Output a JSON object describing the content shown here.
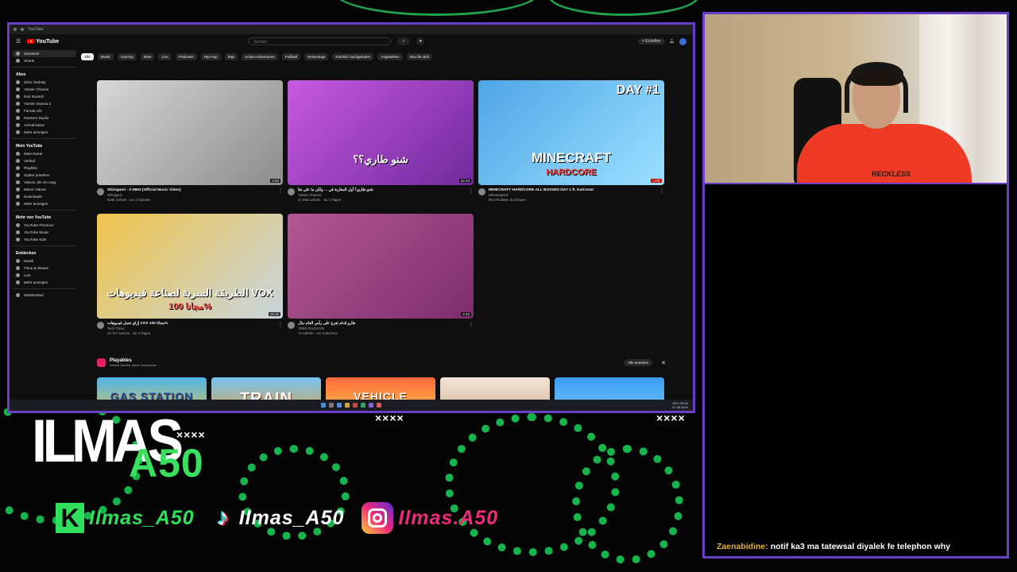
{
  "browser": {
    "tab_title": "YouTube",
    "logo_text": "YouTube",
    "search_placeholder": "Suchen",
    "create_label": "+ Erstellen",
    "chips": [
      "Alle",
      "Musik",
      "Gaming",
      "Mixe",
      "Live",
      "Podcasts",
      "Hip-Hop",
      "Rap",
      "Action-Adventures",
      "Fußball",
      "Reisevlogs",
      "Kürzlich hochgeladen",
      "Angesehen",
      "Neu für dich"
    ],
    "sidebar": {
      "top": [
        "Startseite",
        "Shorts"
      ],
      "subs_head": "Abos",
      "subs": [
        "Simo Sedraty",
        "Yasser Chanea",
        "Ilias Soumiti",
        "Yasser chanea 2",
        "Farouk Life",
        "Ransom Studio",
        "Achraf kabur",
        "Mehr anzeigen"
      ],
      "you_head": "Mein YouTube",
      "you": [
        "Mein Kanal",
        "Verlauf",
        "Playlists",
        "Später ansehen",
        "Videos, die ich mag",
        "Meine Videos",
        "Downloads",
        "Mehr anzeigen"
      ],
      "more_head": "Mehr von YouTube",
      "more": [
        "YouTube Premium",
        "YouTube Music",
        "YouTube Kids"
      ],
      "explore_head": "Entdecken",
      "explore": [
        "Musik",
        "Filme & Shows",
        "Live",
        "Mehr anzeigen"
      ],
      "bottom": [
        "Mobilverlauf"
      ]
    },
    "videos": [
      {
        "title": "Shinigami - X-MEN (Official Music Video)",
        "channel": "Shinigami",
        "stats": "516k Aufrufe · vor 3 Stunden",
        "duration": "3:03",
        "colors": [
          "#d7d7d7",
          "#8c8c8c"
        ]
      },
      {
        "title": "شنو طاري؟ أول المغاربة في ... ولكن ما علي بغا",
        "channel": "Yasser Chanea",
        "stats": "37.556 Aufrufe · vor 2 Tagen",
        "duration": "32:23",
        "thumb_text": "شنو طاري؟؟",
        "colors": [
          "#c75ae0",
          "#6f2a9c"
        ]
      },
      {
        "title": "MINECRAFT HARDCORE ALL BOSSES DAY 1 ft. KaiCenat",
        "channel": "IShowSpeed",
        "stats": "89.278 aktive Zuschauer",
        "duration": "LIVE",
        "thumb_text": "MINECRAFT",
        "thumb_sub": "HARDCORE",
        "badge": "DAY #1",
        "colors": [
          "#4fa5e5",
          "#9be0ff"
        ]
      },
      {
        "title": "إزاي تعمل فيديوهات VOX مجانا 100%",
        "channel": "Tech Tricks",
        "stats": "10.717 Aufrufe · vor 2 Tagen",
        "duration": "16:15",
        "thumb_text": "الطريقة السرية لصناعة فيديوهات VOX",
        "thumb_sub": "مجانا 100%",
        "colors": [
          "#f0c44a",
          "#c8d5de"
        ]
      },
      {
        "title": "طارو قدام تفرج على رأس العام ديال",
        "channel": "TREF PALESTIN",
        "stats": "74 Aufrufe · vor 3 Wochen",
        "duration": "4:43",
        "colors": [
          "#b25893",
          "#7e2d6c"
        ]
      }
    ],
    "playables": {
      "title": "Playables",
      "subtitle": "Instant Games, keine Downloads",
      "see_all": "Alle ansehen",
      "games": [
        {
          "label": "GAS STATION",
          "colors": [
            "#4fb4e8",
            "#f6c441"
          ]
        },
        {
          "label": "TRAIN",
          "colors": [
            "#76c3f2",
            "#f0a030"
          ]
        },
        {
          "label": "VEHICLE MASTERS",
          "colors": [
            "#ff6a3d",
            "#fcd64d"
          ]
        },
        {
          "label": "",
          "colors": [
            "#f2e5d7",
            "#d1a98c"
          ]
        },
        {
          "label": "",
          "colors": [
            "#3a9cf0",
            "#7fd3ff"
          ]
        }
      ]
    },
    "taskbar_time": "23:04",
    "taskbar_date": "07.08.2024",
    "taskbar_lang": "DEU"
  },
  "webcam": {
    "shirt_text": "RECKLESS"
  },
  "chat": {
    "username": "Zaenabidine:",
    "message": "notif ka3 ma tatewsal diyalek fe telephon why"
  },
  "overlay": {
    "logo_top": "ILMAS",
    "logo_bottom": "A50",
    "xmarks_1": "××××",
    "xmarks_2": "××××",
    "xmarks_3": "××××",
    "kick_handle": "Ilmas_A50",
    "tiktok_handle": "Ilmas_A50",
    "instagram_handle": "Ilmas.A50",
    "accent": "#39e05f",
    "frame": "#6a3fc8"
  }
}
